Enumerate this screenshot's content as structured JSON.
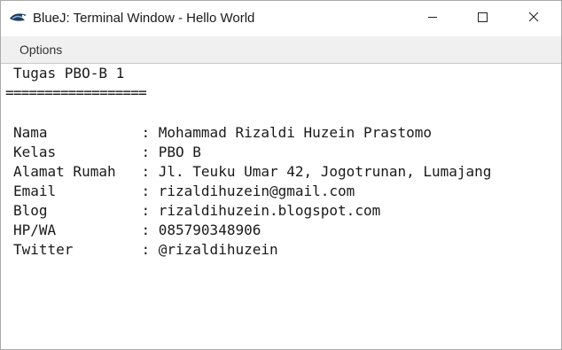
{
  "window": {
    "title": "BlueJ: Terminal Window - Hello World",
    "app_icon": "bluej-bird-icon",
    "controls": [
      "minimize-icon",
      "maximize-icon",
      "close-icon"
    ]
  },
  "menu": {
    "items": [
      {
        "label": "Options"
      }
    ]
  },
  "terminal": {
    "heading": "Tugas PBO-B 1",
    "separator": "==================",
    "rows": [
      {
        "text": "Nama           : Mohammad Rizaldi Huzein Prastomo"
      },
      {
        "text": "Kelas          : PBO B"
      },
      {
        "text": "Alamat Rumah   : Jl. Teuku Umar 42, Jogotrunan, Lumajang"
      },
      {
        "text": "Email          : rizaldihuzein@gmail.com"
      },
      {
        "text": "Blog           : rizaldihuzein.blogspot.com"
      },
      {
        "text": "HP/WA          : 085790348906"
      },
      {
        "text": "Twitter        : @rizaldihuzein"
      }
    ]
  },
  "colors": {
    "background": "#ffffff",
    "menubar": "#f0f0f0",
    "text": "#1a1a1a"
  }
}
